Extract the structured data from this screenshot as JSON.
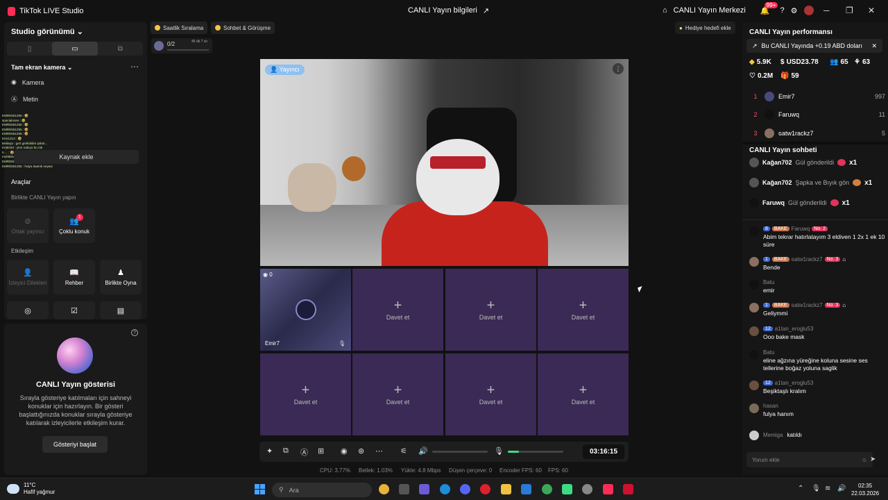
{
  "titlebar": {
    "app_name": "TikTok LIVE Studio",
    "center_title": "CANLI Yayın bilgileri",
    "live_center": "CANLI Yayın Merkezi",
    "notif_badge": "99+"
  },
  "left": {
    "studio_view": "Studio görünümü",
    "scene": "Tam ekran kamera",
    "sources": [
      {
        "icon": "camera-icon",
        "label": "Kamera"
      },
      {
        "icon": "text-icon",
        "label": "Metin"
      }
    ],
    "add_source": "Kaynak ekle",
    "chat_log": [
      "EMRE551255 : 🤣",
      "spacialonee : 🤣",
      "EMRE551255 : 🤣",
      "EMRE551255 : 🤣",
      "EMRE551255 : 🤣",
      "Emr1213 : 🤣",
      "Beliwya : geri gelebildim şükür...",
      "Kralet34 : yine nabıyo bu mk",
      "5 ... : 🤣 ... noluyo",
      "muhittinceli : noliyo",
      "EMRE551255 : bunu bende gördüm olm",
      "EMRE551255 : hulya kaamk neyaw"
    ],
    "tools": "Araçlar",
    "play_together_hint": "Birlikte CANLI Yayın yapın",
    "interaction": "Etkileşim",
    "tiles": [
      {
        "label": "Ortak yayıncı"
      },
      {
        "label": "Çoklu konuk",
        "badge": "1"
      },
      {
        "label": "İzleyici Dilekleri"
      },
      {
        "label": "Rehber"
      },
      {
        "label": "Birlikte Oyna"
      }
    ]
  },
  "show": {
    "title": "CANLI Yayın gösterisi",
    "desc": "Sırayla gösteriye katılmaları için sahneyi konuklar için hazırlayın. Bir gösteri başlattığınızda konuklar sırayla gösteriye katılarak izleyicilerle etkileşim kurar.",
    "button": "Gösteriyi başlat"
  },
  "pills": {
    "hourly": "Saatlik Sıralama",
    "chat": "Sohbet & Görüşme",
    "gift_goal": "Hediye hedefi ekle",
    "progress": "0/2",
    "progress_time": "46 dk 7 sn"
  },
  "video": {
    "host_badge": "Yayıncı"
  },
  "guests": {
    "name": "Emir7",
    "count": "0",
    "invite": "Davet et"
  },
  "controls": {
    "timer": "03:16:15",
    "mic_level": 0.2
  },
  "stats": [
    {
      "label": "CPU: 3.77%"
    },
    {
      "label": "Bellek: 1.03%"
    },
    {
      "label": "Yükle: 4.8 Mbps"
    },
    {
      "label": "Düşen çerçeve: 0"
    },
    {
      "label": "Encoder FPS: 60"
    },
    {
      "label": "FPS: 60"
    }
  ],
  "right": {
    "perf_title": "CANLI Yayın performansı",
    "promo": "Bu CANLI Yayında +0.19 ABD doları",
    "metrics": {
      "diamonds": "5.9K",
      "usd": "USD23.78",
      "viewers": "65",
      "followers": "63",
      "likes": "0.2M",
      "gifts": "59"
    },
    "ranking": [
      {
        "rank": "1",
        "name": "Emir7",
        "val": "997"
      },
      {
        "rank": "2",
        "name": "Faruwq",
        "val": "11"
      },
      {
        "rank": "3",
        "name": "ɢatw1rackz7",
        "val": "5"
      }
    ],
    "chat_title": "CANLI Yayın sohbeti",
    "gift_events": [
      {
        "user": "Kağan702",
        "text": "Gül gönderildi",
        "mult": "x1"
      },
      {
        "user": "Kağan702",
        "text": "Şapka ve Bıyık gön",
        "mult": "x1"
      },
      {
        "user": "Faruwq",
        "text": "Gül gönderildi",
        "mult": "x1"
      }
    ],
    "messages": [
      {
        "lvl": "8",
        "bake": "BAKE",
        "user": "Faruwq",
        "no": "No. 2",
        "text": "Abim tekrar hatırlatayım 3 eldiven 1 2x 1 ek 10 süre"
      },
      {
        "lvl": "1",
        "bake": "BAKE",
        "user": "ɢatw1rackz7",
        "no": "No. 3",
        "text": "Bende"
      },
      {
        "user": "Batu",
        "text": "emir"
      },
      {
        "lvl": "1",
        "bake": "BAKE",
        "user": "ɢatw1rackz7",
        "no": "No. 3",
        "text": "Geliymmi"
      },
      {
        "lvl": "12",
        "user": "a1tan_eroglu53",
        "text": "Ooo bake mask"
      },
      {
        "user": "Batu",
        "text": "eline ağzına yüreğine koluna sesine ses tellerine boğaz yoluna saglik"
      },
      {
        "lvl": "12",
        "user": "a1tan_eroglu53",
        "text": "Beşiktaşlı kralım"
      },
      {
        "user": "hasan",
        "text": "fulya hanım"
      },
      {
        "user": "Memiga",
        "text": "katıldı"
      }
    ],
    "comment_placeholder": "Yorum ekle"
  },
  "taskbar": {
    "temp": "11°C",
    "weather": "Hafif yağmur",
    "search": "Ara",
    "time": "02:35",
    "date": "22.03.2026"
  }
}
